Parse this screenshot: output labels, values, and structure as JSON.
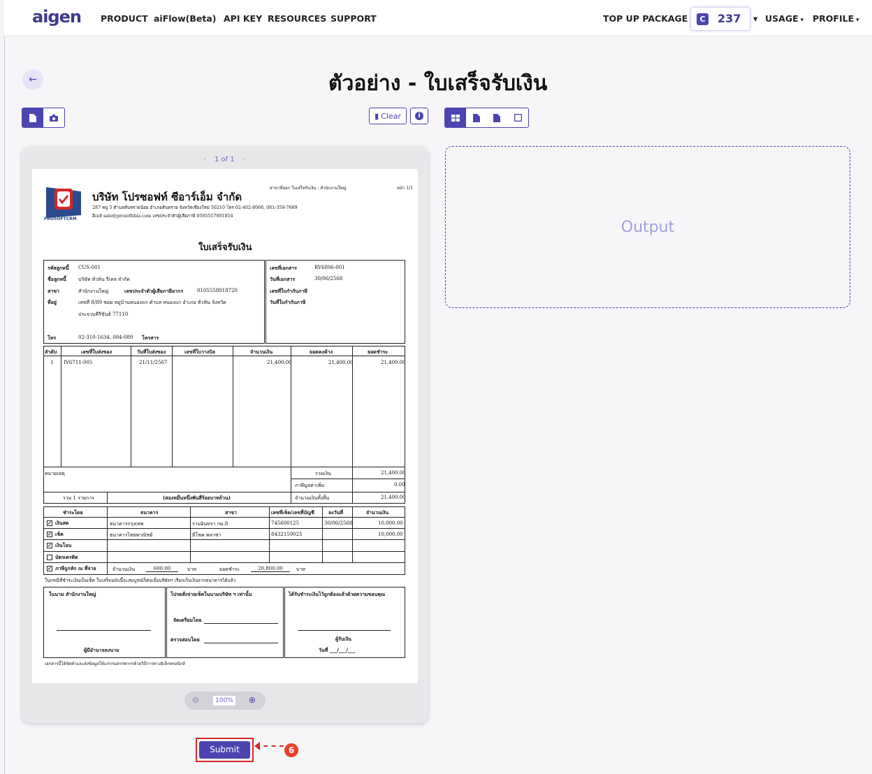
{
  "nav": {
    "logo": "aigen",
    "items": [
      "PRODUCT",
      "aiFlow(Beta)",
      "API KEY",
      "RESOURCES",
      "SUPPORT"
    ],
    "top_up": "TOP UP PACKAGE",
    "credit_icon": "C",
    "credits": "237",
    "usage": "USAGE",
    "profile": "PROFILE"
  },
  "page": {
    "title": "ตัวอย่าง - ใบเสร็จรับเงิน"
  },
  "tools": {
    "clear": "Clear",
    "info_icon": "info-icon"
  },
  "viewer": {
    "pager": "1 of 1",
    "zoom": "100%"
  },
  "output": {
    "placeholder": "Output"
  },
  "submit": {
    "label": "Submit",
    "step": "6"
  },
  "colors": {
    "accent": "#4c45b0",
    "highlight": "#d62828"
  },
  "doc": {
    "branch_issue": "สาขาที่ออก  ใบเสร็จรับเงิน : สำนักงานใหญ่",
    "page_no": "หน้า 1/1",
    "company": "บริษัท โปรซอฟท์ ซีอาร์เอ็ม จำกัด",
    "company_addr": "287 หมู่ 5 ตำบลสันทรายน้อย อำเภอสันทราย จังหวัดเชียงใหม่ 50210 โทร 02-402-8068, 081-359-7689",
    "company_email": "อีเมล์ sale@prosoftibiz.com เลขประจำตัวผู้เสียภาษี 0505557001854",
    "logo_text": "PROSOFTCRM",
    "doc_title": "ใบเสร็จรับเงิน",
    "cust": {
      "code_label": "รหัสลูกหนี้",
      "code": "CUS-001",
      "name_label": "ชื่อลูกหนี้",
      "name": "บริษัท หัวหิน รีเทล จำกัด",
      "branch_label": "สาขา",
      "branch": "สำนักงานใหญ่",
      "taxid_label": "เลขประจำตัวผู้เสียภาษีอากร",
      "taxid": "0105558018720",
      "addr_label": "ที่อยู่",
      "addr1": "เลขที่ 8/89 ซอย หมู่บ้านหนองแก ตำบล หนองแก อำเภอ หัวหิน จังหวัด",
      "addr2": "ประจวบคีรีขันธ์ 77110",
      "tel_label": "โทร",
      "tel": "02-310-1634, 084-089",
      "fax_label": "โทรสาร"
    },
    "info": {
      "docno_label": "เลขที่เอกสาร",
      "docno": "RV6806-001",
      "date_label": "วันที่เอกสาร",
      "date": "30/06/2568",
      "taxinv_label": "เลขที่ใบกำกับภาษี",
      "taxdate_label": "วันที่ใบกำกับภาษี"
    },
    "table_headers": [
      "ลำดับ",
      "เลขที่ใบส่งของ",
      "วันที่ใบส่งของ",
      "เลขที่ใบวางบิล",
      "จำนวนเงิน",
      "ยอดคงค้าง",
      "ยอดชำระ"
    ],
    "rows": [
      [
        "1",
        "IV6711-005",
        "21/11/2567",
        "",
        "21,400.00",
        "21,400.00",
        "21,400.00"
      ]
    ],
    "remark_label": "หมายเหตุ",
    "sum_label": "รวมเงิน",
    "sum": "21,400.00",
    "vat_label": "ภาษีมูลค่าเพิ่ม",
    "vat": "0.00",
    "total_label": "จำนวนเงินทั้งสิ้น",
    "total": "21,400.00",
    "count": "รวม 1 รายการ",
    "amount_words": "(สองหมื่นหนึ่งพันสี่ร้อยบาทถ้วน)",
    "pay_headers": [
      "ชำระโดย",
      "ธนาคาร",
      "สาขา",
      "เลขที่เช็ค/เลขที่บัญชี",
      "ลงวันที่",
      "จำนวนเงิน"
    ],
    "pay_rows": [
      {
        "check": "✓",
        "method": "เงินสด",
        "bank": "ธนาคารกรุงเทพ",
        "branch": "รามอินทรา กม.8",
        "no": "745600125",
        "date": "30/06/2568",
        "amount": "10,000.00"
      },
      {
        "check": "✓",
        "method": "เช็ค",
        "bank": "ธนาคารไทยพาณิชย์",
        "branch": "มีโชค พลาซ่า",
        "no": "8432159025",
        "date": "",
        "amount": "10,000.00"
      },
      {
        "check": "✓",
        "method": "เงินโอน",
        "bank": "",
        "branch": "",
        "no": "",
        "date": "",
        "amount": ""
      },
      {
        "check": "",
        "method": "บัตรเครดิต",
        "bank": "",
        "branch": "",
        "no": "",
        "date": "",
        "amount": ""
      }
    ],
    "wht_check": "✓",
    "wht_label": "ภาษีถูกหัก ณ ที่จ่าย",
    "wht_amt_label": "จำนวนเงิน",
    "wht_amt": "600.00",
    "baht": "บาท",
    "paid_label": "ยอดชำระ",
    "paid": "20,800.00",
    "cheque_note": "ในกรณีที่ชำระเงินเป็นเช็ค ใบเสร็จฉบับนี้จะสมบูรณ์ก็ต่อเมื่อบริษัทฯ เรียกเก็บเงินจากธนาคารได้แล้ว",
    "sig1_title": "ในนาม สำนักงานใหญ่",
    "sig1_name": "ผู้มีอำนาจลงนาม",
    "sig2_title": "โปรดสั่งจ่ายเช็คในนามบริษัท ฯ เท่านั้น",
    "sig2_prep": "จัดเตรียมโดย",
    "sig2_check": "ตรวจสอบโดย",
    "sig3_title": "ได้รับชำระเงินไว้ถูกต้องแล้วด้วยความขอบคุณ",
    "sig3_name": "ผู้รับเงิน",
    "sig3_date": "วันที่  ___/___/___",
    "footer": "เอกสารนี้ได้จัดทำและส่งข้อมูลให้แก่กรมสรรพากรด้วยวิธีการทางอิเล็กทรอนิกส์"
  }
}
